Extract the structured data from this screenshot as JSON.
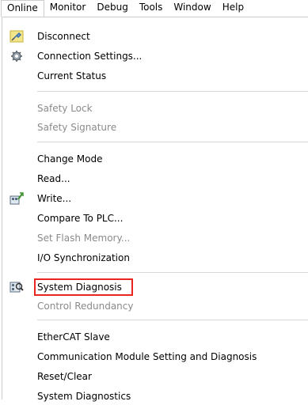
{
  "menubar": {
    "items": [
      {
        "label": "Online"
      },
      {
        "label": "Monitor"
      },
      {
        "label": "Debug"
      },
      {
        "label": "Tools"
      },
      {
        "label": "Window"
      },
      {
        "label": "Help"
      }
    ]
  },
  "online_menu": {
    "items": [
      {
        "label": "Disconnect",
        "icon": "disconnect-icon",
        "enabled": true
      },
      {
        "label": "Connection Settings...",
        "icon": "connection-settings-icon",
        "enabled": true
      },
      {
        "label": "Current Status",
        "enabled": true
      },
      {
        "label": "Safety Lock",
        "enabled": false
      },
      {
        "label": "Safety Signature",
        "enabled": false
      },
      {
        "label": "Change Mode",
        "enabled": true
      },
      {
        "label": "Read...",
        "enabled": true
      },
      {
        "label": "Write...",
        "icon": "write-icon",
        "enabled": true
      },
      {
        "label": "Compare To PLC...",
        "enabled": true
      },
      {
        "label": "Set Flash Memory...",
        "enabled": false
      },
      {
        "label": "I/O Synchronization",
        "enabled": true
      },
      {
        "label": "System Diagnosis",
        "icon": "system-diagnosis-icon",
        "enabled": true,
        "highlighted": true
      },
      {
        "label": "Control Redundancy",
        "enabled": false
      },
      {
        "label": "EtherCAT Slave",
        "enabled": true
      },
      {
        "label": "Communication Module Setting and Diagnosis",
        "enabled": true
      },
      {
        "label": "Reset/Clear",
        "enabled": true
      },
      {
        "label": "System Diagnostics",
        "enabled": true
      }
    ]
  },
  "colors": {
    "highlight_border": "#e8251f",
    "disabled_text": "#8a8a8a",
    "separator": "#d7d7d7"
  }
}
